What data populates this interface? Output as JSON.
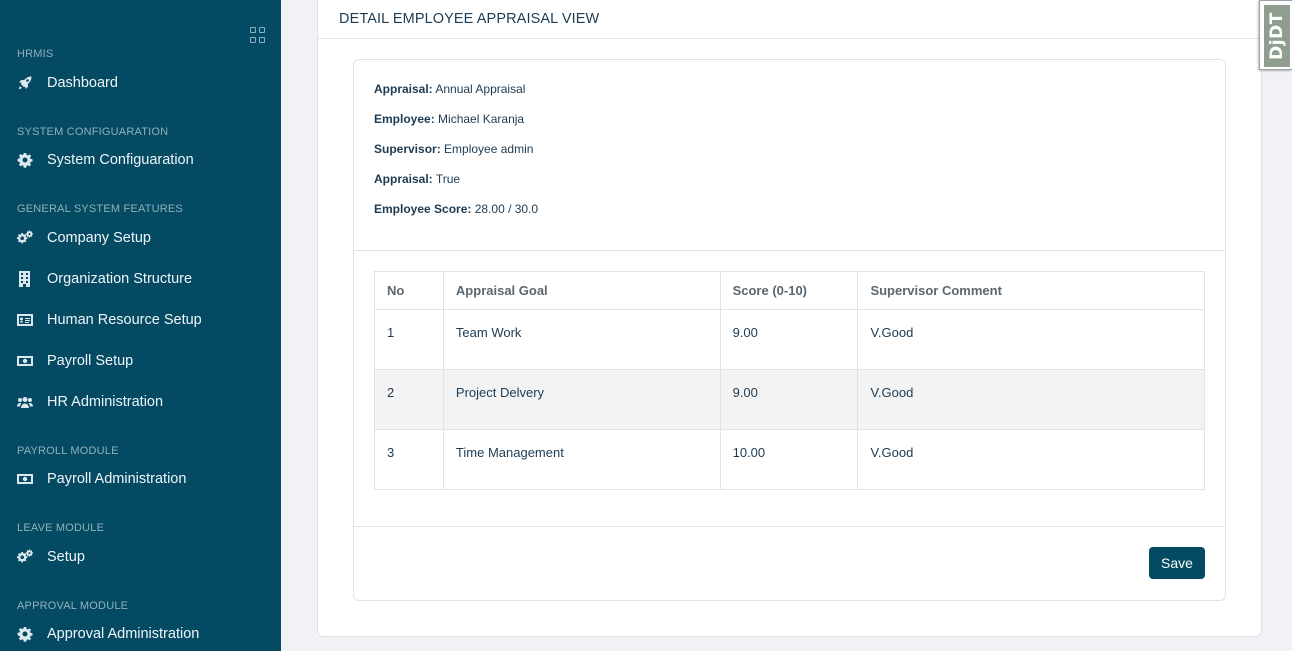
{
  "sidebar": {
    "sections": [
      {
        "label": "HRMIS"
      },
      {
        "label": "SYSTEM CONFIGUARATION"
      },
      {
        "label": "GENERAL SYSTEM FEATURES"
      },
      {
        "label": "PAYROLL MODULE"
      },
      {
        "label": "LEAVE MODULE"
      },
      {
        "label": "APPROVAL MODULE"
      }
    ],
    "items": [
      {
        "label": "Dashboard",
        "icon": "rocket-icon"
      },
      {
        "label": "System Configuaration",
        "icon": "gear-icon"
      },
      {
        "label": "Company Setup",
        "icon": "gears-icon"
      },
      {
        "label": "Organization Structure",
        "icon": "building-icon"
      },
      {
        "label": "Human Resource Setup",
        "icon": "id-card-icon"
      },
      {
        "label": "Payroll Setup",
        "icon": "money-bill-icon"
      },
      {
        "label": "HR Administration",
        "icon": "users-icon"
      },
      {
        "label": "Payroll Administration",
        "icon": "money-bill-icon"
      },
      {
        "label": "Setup",
        "icon": "gears-icon"
      },
      {
        "label": "Approval Administration",
        "icon": "gear-icon"
      }
    ]
  },
  "page": {
    "title": "DETAIL EMPLOYEE APPRAISAL VIEW"
  },
  "details": [
    {
      "label": "Appraisal:",
      "value": "Annual Appraisal"
    },
    {
      "label": "Employee:",
      "value": "Michael Karanja"
    },
    {
      "label": "Supervisor:",
      "value": "Employee admin"
    },
    {
      "label": "Appraisal:",
      "value": "True"
    },
    {
      "label": "Employee Score:",
      "value": "28.00 / 30.0"
    }
  ],
  "table": {
    "headers": [
      "No",
      "Appraisal Goal",
      "Score (0-10)",
      "Supervisor Comment"
    ],
    "rows": [
      [
        "1",
        "Team Work",
        "9.00",
        "V.Good"
      ],
      [
        "2",
        "Project Delvery",
        "9.00",
        "V.Good"
      ],
      [
        "3",
        "Time Management",
        "10.00",
        "V.Good"
      ]
    ]
  },
  "actions": {
    "save_label": "Save"
  },
  "debug_toolbar": {
    "label": "DjDT"
  },
  "colors": {
    "sidebar_bg": "#044a62",
    "button_bg": "#044a62",
    "text": "#1d3b53"
  }
}
